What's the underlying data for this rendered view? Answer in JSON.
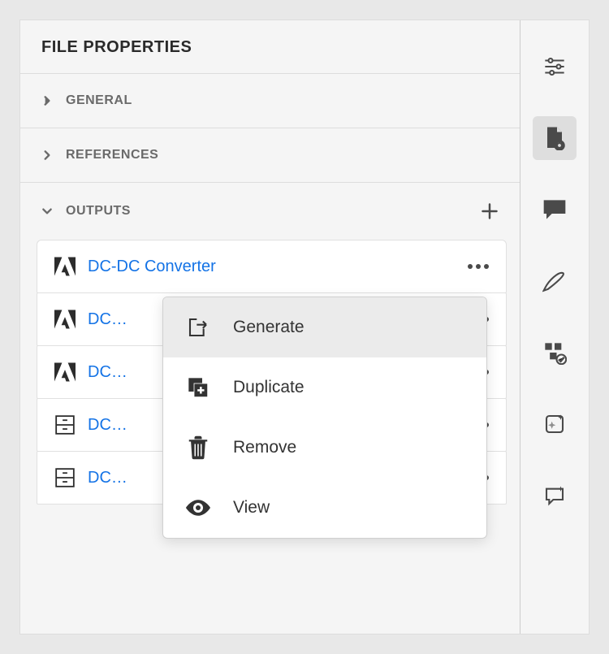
{
  "header": {
    "title": "FILE PROPERTIES"
  },
  "sections": {
    "general": {
      "label": "GENERAL",
      "expanded": false
    },
    "references": {
      "label": "REFERENCES",
      "expanded": false
    },
    "outputs": {
      "label": "OUTPUTS",
      "expanded": true
    }
  },
  "outputs": [
    {
      "title": "DC-DC Converter",
      "icon": "adobe"
    },
    {
      "title": "DC-DC Converter",
      "icon": "adobe"
    },
    {
      "title": "DC-DC Converter",
      "icon": "adobe"
    },
    {
      "title": "DC-DC Converter",
      "icon": "cabinet"
    },
    {
      "title": "DC-DC Converter",
      "icon": "cabinet"
    }
  ],
  "context_menu": {
    "items": [
      {
        "label": "Generate",
        "icon": "export",
        "hover": true
      },
      {
        "label": "Duplicate",
        "icon": "duplicate"
      },
      {
        "label": "Remove",
        "icon": "trash"
      },
      {
        "label": "View",
        "icon": "eye"
      }
    ]
  },
  "rail": [
    {
      "name": "settings",
      "active": false
    },
    {
      "name": "file-properties",
      "active": true
    },
    {
      "name": "comments",
      "active": false
    },
    {
      "name": "edit-pen",
      "active": false
    },
    {
      "name": "components",
      "active": false
    },
    {
      "name": "sparkle-box",
      "active": false
    },
    {
      "name": "sparkle-chat",
      "active": false
    }
  ]
}
